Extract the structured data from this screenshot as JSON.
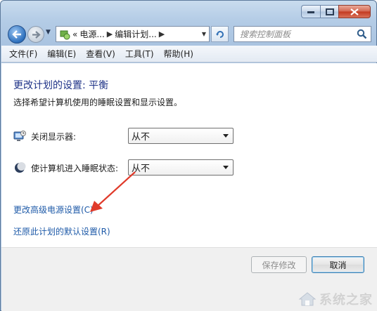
{
  "window": {
    "caption_buttons": [
      "minimize",
      "maximize",
      "close"
    ]
  },
  "address_bar": {
    "overflow": "«",
    "crumbs": [
      "电源...",
      "编辑计划..."
    ]
  },
  "search": {
    "placeholder": "搜索控制面板"
  },
  "menu": {
    "items": [
      "文件(F)",
      "编辑(E)",
      "查看(V)",
      "工具(T)",
      "帮助(H)"
    ]
  },
  "content": {
    "title": "更改计划的设置: 平衡",
    "description": "选择希望计算机使用的睡眠设置和显示设置。",
    "settings": [
      {
        "label": "关闭显示器:",
        "value": "从不",
        "icon": "monitor-icon"
      },
      {
        "label": "使计算机进入睡眠状态:",
        "value": "从不",
        "icon": "sleep-moon-icon"
      }
    ],
    "links": {
      "advanced": "更改高级电源设置(C)",
      "restore": "还原此计划的默认设置(R)"
    }
  },
  "footer": {
    "save_label": "保存修改",
    "cancel_label": "取消"
  },
  "watermark": {
    "text": "系统之家"
  },
  "colors": {
    "title": "#1e3287",
    "link": "#1e5aa8",
    "annotation_arrow": "#e03a2a"
  }
}
